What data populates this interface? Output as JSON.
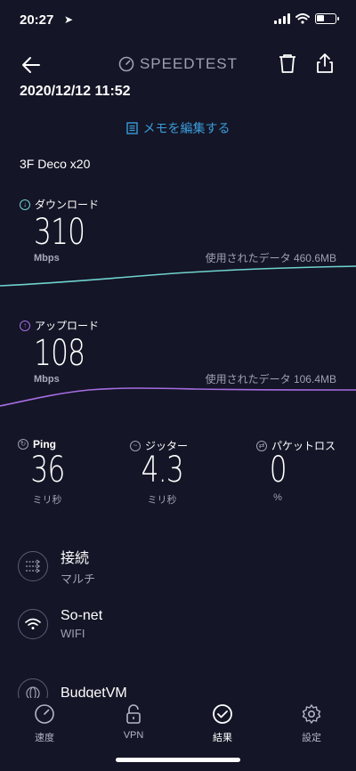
{
  "status": {
    "time": "20:27"
  },
  "header": {
    "brand": "SPEEDTEST"
  },
  "datetime": "2020/12/12 11:52",
  "memo_label": "メモを編集する",
  "server": "3F Deco x20",
  "download": {
    "label": "ダウンロード",
    "value": "310",
    "unit": "Mbps",
    "used": "使用されたデータ 460.6MB",
    "color": "#6fd3cf"
  },
  "upload": {
    "label": "アップロード",
    "value": "108",
    "unit": "Mbps",
    "used": "使用されたデータ 106.4MB",
    "color": "#a56de2"
  },
  "ping": {
    "label": "Ping",
    "value": "36",
    "unit": "ミリ秒"
  },
  "jitter": {
    "label": "ジッター",
    "value": "4.3",
    "unit": "ミリ秒"
  },
  "loss": {
    "label": "パケットロス",
    "value": "0",
    "unit": "%"
  },
  "connection": {
    "title": "接続",
    "sub": "マルチ"
  },
  "isp": {
    "title": "So-net",
    "sub": "WIFI"
  },
  "server_info": {
    "title": "BudgetVM"
  },
  "tabs": [
    {
      "label": "速度",
      "icon": "speedometer-icon"
    },
    {
      "label": "VPN",
      "icon": "lock-icon"
    },
    {
      "label": "結果",
      "icon": "check-circle-icon"
    },
    {
      "label": "設定",
      "icon": "gear-icon"
    }
  ]
}
